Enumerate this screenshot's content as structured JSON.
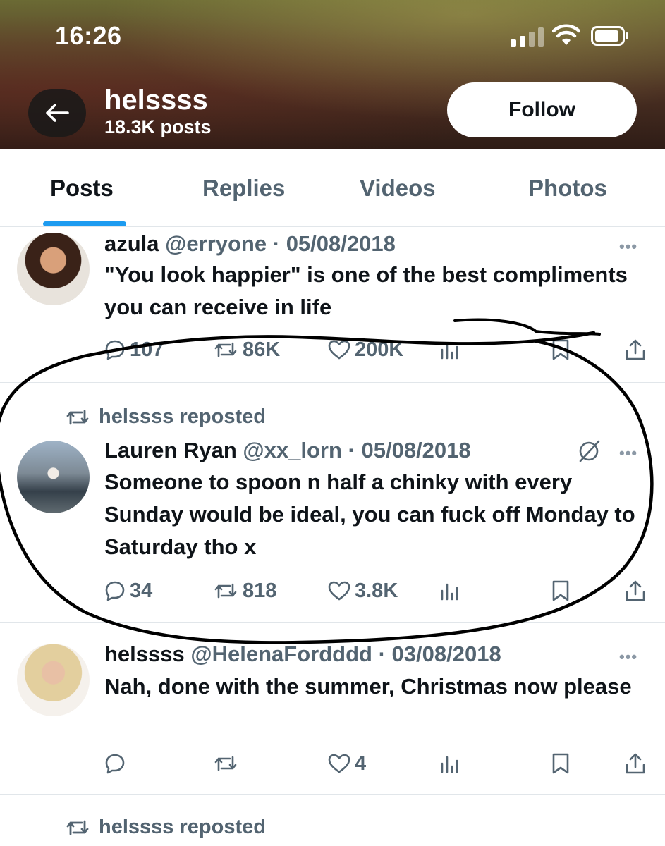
{
  "status_bar": {
    "time": "16:26"
  },
  "header": {
    "profile_name": "helssss",
    "post_count": "18.3K posts",
    "follow_label": "Follow"
  },
  "tabs": [
    {
      "label": "Posts",
      "active": true
    },
    {
      "label": "Replies",
      "active": false
    },
    {
      "label": "Videos",
      "active": false
    },
    {
      "label": "Photos",
      "active": false
    }
  ],
  "posts": [
    {
      "display_name": "azula",
      "handle": "@erryone",
      "date": "05/08/2018",
      "text": "\"You look happier\" is one of the best compliments you can receive in life",
      "stats": {
        "replies": "107",
        "reposts": "86K",
        "likes": "200K"
      }
    },
    {
      "repost_label": "helssss reposted",
      "display_name": "Lauren Ryan",
      "handle": "@xx_lorn",
      "date": "05/08/2018",
      "text": "Someone to spoon n half a chinky with every Sunday would be ideal, you can fuck off Monday to Saturday tho x",
      "stats": {
        "replies": "34",
        "reposts": "818",
        "likes": "3.8K"
      }
    },
    {
      "display_name": "helssss",
      "handle": "@HelenaFordddd",
      "date": "03/08/2018",
      "text": "Nah, done with the summer, Christmas now please",
      "stats": {
        "replies": "",
        "reposts": "",
        "likes": "4"
      }
    },
    {
      "repost_label": "helssss reposted"
    }
  ],
  "separator": "·",
  "more_glyph": "•••",
  "icons": [
    "back-arrow-icon",
    "signal-icon",
    "wifi-icon",
    "battery-icon",
    "reply-icon",
    "repost-icon",
    "like-icon",
    "views-icon",
    "bookmark-icon",
    "share-icon",
    "more-icon",
    "no-notify-icon"
  ],
  "colors": {
    "accent": "#1d9bf0",
    "text": "#0f1419",
    "muted": "#536471",
    "divider": "#e1e6ea"
  }
}
